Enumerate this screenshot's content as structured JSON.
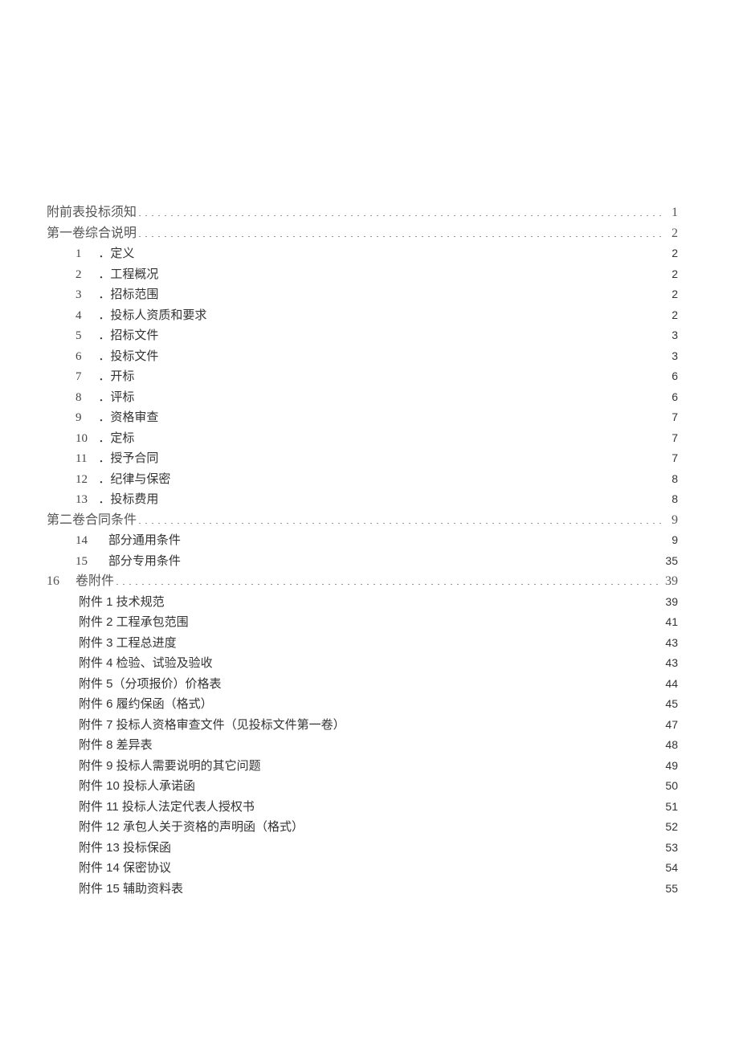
{
  "toc": {
    "top": [
      {
        "title": "附前表投标须知",
        "page": "1"
      },
      {
        "title": "第一卷综合说明",
        "page": "2"
      }
    ],
    "section1": [
      {
        "num": "1",
        "title": "．定义",
        "page": "2"
      },
      {
        "num": "2",
        "title": "．工程概况",
        "page": "2"
      },
      {
        "num": "3",
        "title": "．招标范围",
        "page": "2"
      },
      {
        "num": "4",
        "title": "．投标人资质和要求",
        "page": "2"
      },
      {
        "num": "5",
        "title": "．招标文件",
        "page": "3"
      },
      {
        "num": "6",
        "title": "．投标文件",
        "page": "3"
      },
      {
        "num": "7",
        "title": "．开标",
        "page": "6"
      },
      {
        "num": "8",
        "title": "．评标",
        "page": "6"
      },
      {
        "num": "9",
        "title": "．资格审查",
        "page": "7"
      },
      {
        "num": "10",
        "title": "．定标",
        "page": "7"
      },
      {
        "num": "11",
        "title": "．授予合同",
        "page": "7"
      },
      {
        "num": "12",
        "title": "．纪律与保密",
        "page": "8"
      },
      {
        "num": "13",
        "title": "．投标费用",
        "page": "8"
      }
    ],
    "section2_header": {
      "title": "第二卷合同条件",
      "page": "9"
    },
    "section2": [
      {
        "num": "14",
        "title": "部分通用条件",
        "page": "9"
      },
      {
        "num": "15",
        "title": "部分专用条件",
        "page": "35"
      }
    ],
    "section3_header": {
      "num": "16",
      "title": "卷附件",
      "page": "39"
    },
    "appendices": [
      {
        "title": "附件 1 技术规范",
        "page": "39"
      },
      {
        "title": "附件 2 工程承包范围",
        "page": "41"
      },
      {
        "title": "附件 3 工程总进度",
        "page": "43"
      },
      {
        "title": "附件 4 检验、试验及验收",
        "page": "43"
      },
      {
        "title": "附件 5（分项报价）价格表",
        "page": "44"
      },
      {
        "title": "附件 6 履约保函（格式）",
        "page": "45"
      },
      {
        "title": "附件 7 投标人资格审查文件（见投标文件第一卷）",
        "page": "47"
      },
      {
        "title": "附件 8 差异表",
        "page": "48"
      },
      {
        "title": "附件 9 投标人需要说明的其它问题",
        "page": "49"
      },
      {
        "title": "附件 10 投标人承诺函",
        "page": "50"
      },
      {
        "title": "附件 11 投标人法定代表人授权书",
        "page": "51"
      },
      {
        "title": "附件 12 承包人关于资格的声明函（格式）",
        "page": "52"
      },
      {
        "title": "附件 13 投标保函",
        "page": "53"
      },
      {
        "title": "附件 14 保密协议",
        "page": "54"
      },
      {
        "title": "附件 15 辅助资料表",
        "page": "55"
      }
    ]
  }
}
